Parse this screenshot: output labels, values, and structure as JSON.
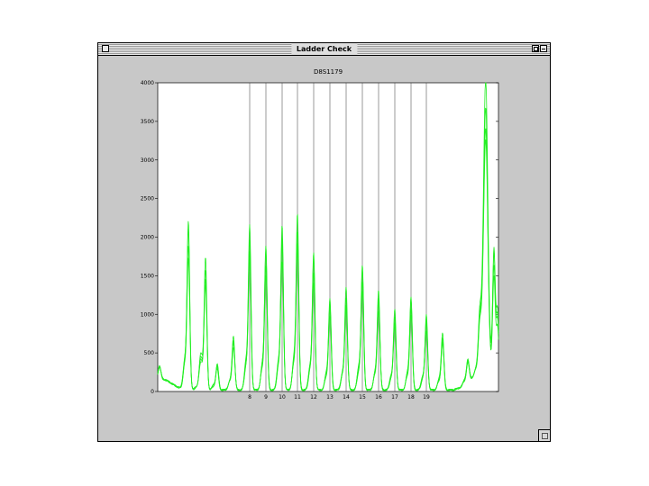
{
  "window": {
    "title": "Ladder Check"
  },
  "chart_data": {
    "type": "line",
    "title": "D8S1179",
    "xlabel": "",
    "ylabel": "",
    "ylim": [
      0,
      4000
    ],
    "yticks": [
      0,
      500,
      1000,
      1500,
      2000,
      2500,
      3000,
      3500,
      4000
    ],
    "grid": false,
    "series_color": "#22ee22",
    "allele_markers": [
      "8",
      "9",
      "10",
      "11",
      "12",
      "13",
      "14",
      "15",
      "16",
      "17",
      "18",
      "19"
    ],
    "peaks": [
      {
        "label": "",
        "height": 180
      },
      {
        "label": "",
        "height": 2150
      },
      {
        "label": "",
        "height": 260
      },
      {
        "label": "",
        "height": 1650
      },
      {
        "label": "",
        "height": 340
      },
      {
        "label": "",
        "height": 690
      },
      {
        "label": "8",
        "height": 2050
      },
      {
        "label": "9",
        "height": 1850
      },
      {
        "label": "10",
        "height": 2100
      },
      {
        "label": "11",
        "height": 2200
      },
      {
        "label": "12",
        "height": 1750
      },
      {
        "label": "13",
        "height": 1180
      },
      {
        "label": "14",
        "height": 1270
      },
      {
        "label": "15",
        "height": 1600
      },
      {
        "label": "16",
        "height": 1280
      },
      {
        "label": "17",
        "height": 1000
      },
      {
        "label": "18",
        "height": 1200
      },
      {
        "label": "19",
        "height": 960
      },
      {
        "label": "",
        "height": 720
      },
      {
        "label": "",
        "height": 300
      },
      {
        "label": "",
        "height": 500
      },
      {
        "label": "",
        "height": 3600
      },
      {
        "label": "",
        "height": 1600
      },
      {
        "label": "",
        "height": 1000
      }
    ]
  }
}
